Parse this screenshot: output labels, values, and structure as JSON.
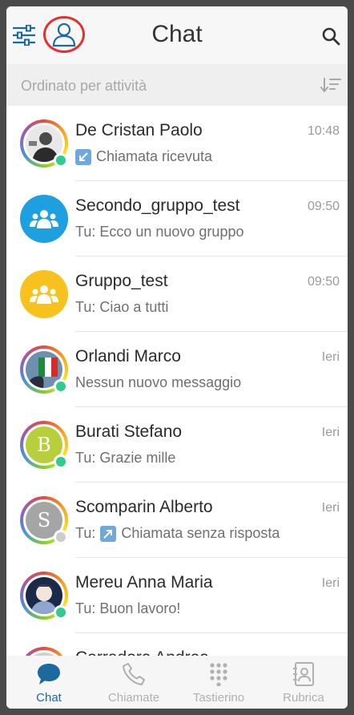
{
  "header": {
    "title": "Chat",
    "settings_icon": "sliders-icon",
    "profile_icon": "user-icon",
    "search_icon": "search-icon"
  },
  "sortbar": {
    "label": "Ordinato per attività",
    "sort_icon": "sort-icon"
  },
  "colors": {
    "accent": "#1a6aa0",
    "online": "#2ecc8f",
    "offline": "#cccccc",
    "group_blue": "#1ea0e0",
    "group_yellow": "#f7c21d",
    "call_icon": "#6fa8dc",
    "highlight_ring": "#e53030"
  },
  "chats": [
    {
      "name": "De Cristan Paolo",
      "time": "10:48",
      "prefix": "",
      "preview": "Chiamata ricevuta",
      "call_icon": "incoming-call-icon",
      "avatar": "photo",
      "status": "online"
    },
    {
      "name": "Secondo_gruppo_test",
      "time": "09:50",
      "prefix": "",
      "preview": "Tu: Ecco un nuovo gruppo",
      "avatar": "group-blue"
    },
    {
      "name": "Gruppo_test",
      "time": "09:50",
      "prefix": "",
      "preview": "Tu: Ciao a tutti",
      "avatar": "group-yellow"
    },
    {
      "name": "Orlandi Marco",
      "time": "Ieri",
      "prefix": "",
      "preview": "Nessun nuovo messaggio",
      "avatar": "photo",
      "status": "online"
    },
    {
      "name": "Burati Stefano",
      "time": "Ieri",
      "prefix": "",
      "preview": "Tu: Grazie mille",
      "avatar": "letter",
      "initial": "B",
      "status": "online"
    },
    {
      "name": "Scomparin Alberto",
      "time": "Ieri",
      "prefix": "Tu:",
      "preview": "Chiamata senza risposta",
      "call_icon": "outgoing-call-icon",
      "avatar": "letter",
      "initial": "S",
      "status": "offline"
    },
    {
      "name": "Mereu Anna Maria",
      "time": "Ieri",
      "prefix": "",
      "preview": "Tu: Buon lavoro!",
      "avatar": "photo",
      "status": "online"
    },
    {
      "name": "Corradora Andrea",
      "time": "",
      "prefix": "",
      "preview": "",
      "avatar": "photo"
    }
  ],
  "nav": [
    {
      "label": "Chat",
      "icon": "chat-bubble-icon",
      "active": true
    },
    {
      "label": "Chiamate",
      "icon": "phone-icon",
      "active": false
    },
    {
      "label": "Tastierino",
      "icon": "keypad-icon",
      "active": false
    },
    {
      "label": "Rubrica",
      "icon": "contacts-book-icon",
      "active": false
    }
  ]
}
